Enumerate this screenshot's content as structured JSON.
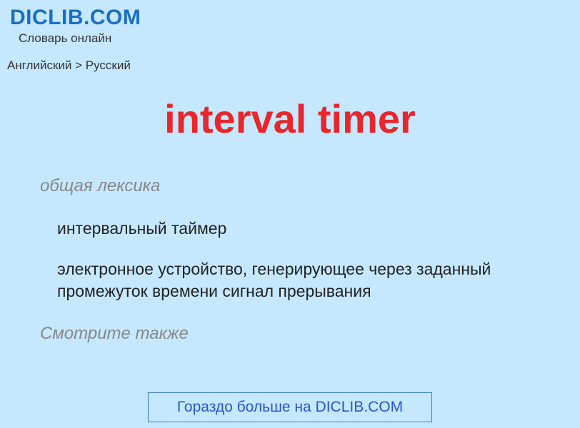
{
  "header": {
    "site_title": "DICLIB.COM",
    "site_subtitle": "Словарь онлайн"
  },
  "breadcrumb": {
    "text": "Английский > Русский"
  },
  "entry": {
    "term": "interval timer",
    "category": "общая лексика",
    "definitions": [
      "интервальный таймер",
      "электронное устройство, генерирующее через заданный промежуток времени сигнал прерывания"
    ],
    "see_also_label": "Смотрите также"
  },
  "cta": {
    "text": "Гораздо больше на DICLIB.COM"
  }
}
